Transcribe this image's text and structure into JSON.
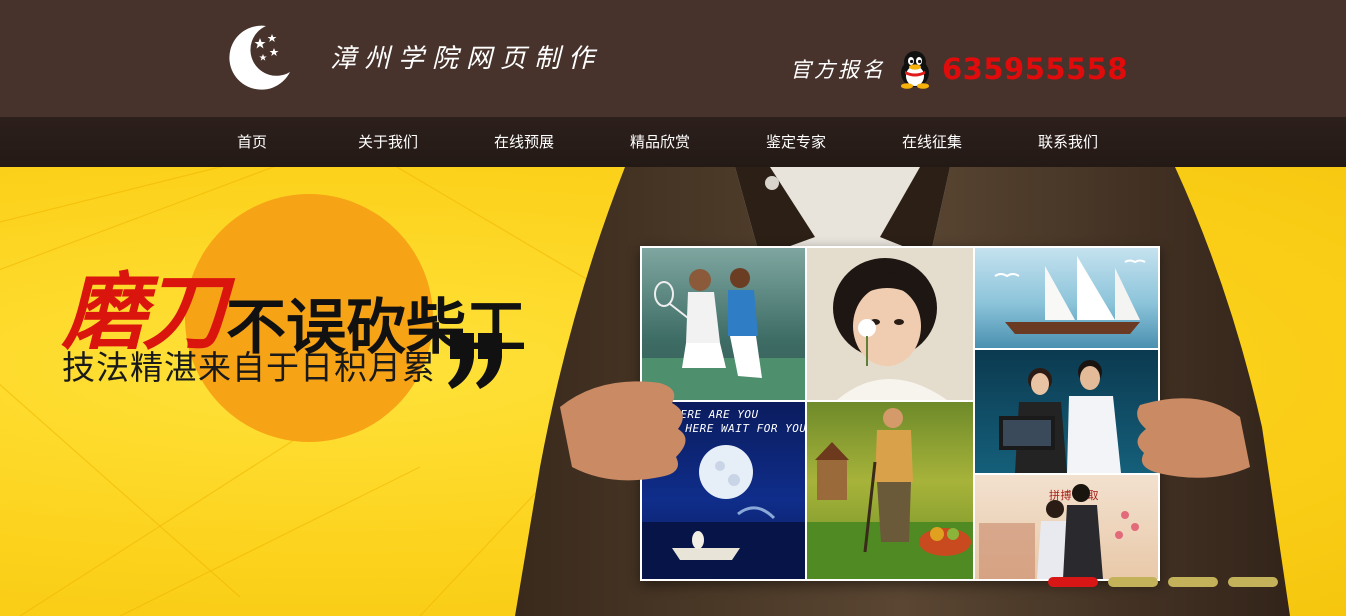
{
  "header": {
    "logo_text": "漳州学院网页制作",
    "signup_label": "官方报名",
    "phone": "635955558"
  },
  "icons": {
    "logo": "moon-stars-logo-icon",
    "qq": "qq-penguin-icon"
  },
  "nav": {
    "items": [
      {
        "label": "首页"
      },
      {
        "label": "关于我们"
      },
      {
        "label": "在线预展"
      },
      {
        "label": "精品欣赏"
      },
      {
        "label": "鉴定专家"
      },
      {
        "label": "在线征集"
      },
      {
        "label": "联系我们"
      }
    ]
  },
  "banner": {
    "slogan_red": "磨刀",
    "slogan_black": "不误砍柴工",
    "slogan_sub": "技法精湛来自于日积月累",
    "tiles": {
      "moon_caption_1": "WHERE ARE YOU",
      "moon_caption_2": "AM HERE WAIT FOR YOU",
      "business_caption": "拼搏·进取"
    },
    "slides": {
      "count": 4,
      "active_index": 0
    }
  },
  "colors": {
    "header_bg": "#47332c",
    "nav_bg": "#2d201c",
    "banner_yellow": "#fcd21c",
    "accent_red": "#e20b0b"
  }
}
